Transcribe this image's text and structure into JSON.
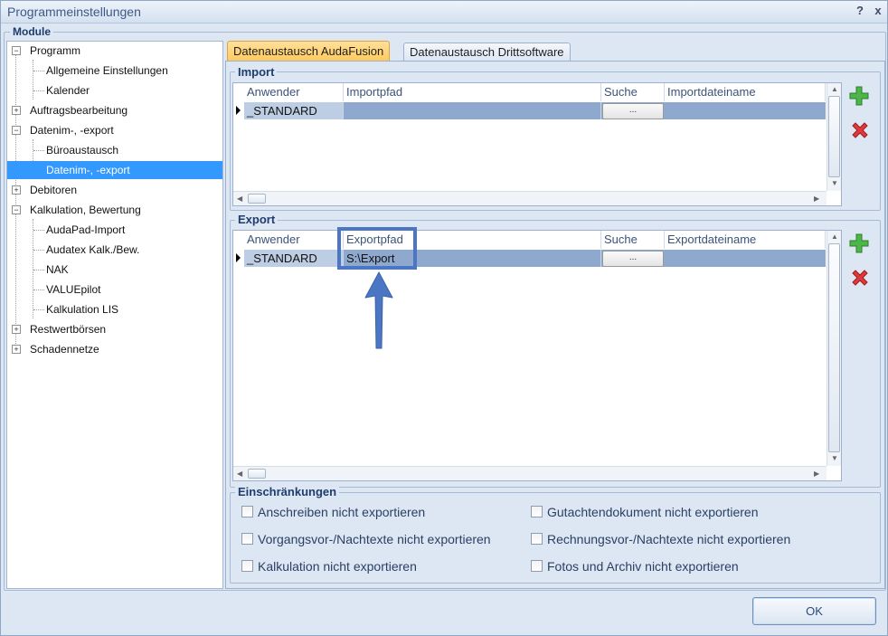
{
  "window": {
    "title": "Programmeinstellungen",
    "help": "?",
    "close": "x"
  },
  "module_group": {
    "label": "Module"
  },
  "tree": {
    "items": [
      {
        "label": "Programm",
        "level": 0,
        "expander": "−"
      },
      {
        "label": "Allgemeine Einstellungen",
        "level": 1
      },
      {
        "label": "Kalender",
        "level": 1
      },
      {
        "label": "Auftragsbearbeitung",
        "level": 0,
        "expander": "+"
      },
      {
        "label": "Datenim-, -export",
        "level": 0,
        "expander": "−"
      },
      {
        "label": "Büroaustausch",
        "level": 1
      },
      {
        "label": "Datenim-, -export",
        "level": 1,
        "selected": true
      },
      {
        "label": "Debitoren",
        "level": 0,
        "expander": "+"
      },
      {
        "label": "Kalkulation, Bewertung",
        "level": 0,
        "expander": "−"
      },
      {
        "label": "AudaPad-Import",
        "level": 1
      },
      {
        "label": "Audatex Kalk./Bew.",
        "level": 1
      },
      {
        "label": "NAK",
        "level": 1
      },
      {
        "label": "VALUEpilot",
        "level": 1
      },
      {
        "label": "Kalkulation LIS",
        "level": 1
      },
      {
        "label": "Restwertbörsen",
        "level": 0,
        "expander": "+"
      },
      {
        "label": "Schadennetze",
        "level": 0,
        "expander": "+"
      }
    ]
  },
  "tabs": [
    {
      "label": "Datenaustausch AudaFusion",
      "active": true
    },
    {
      "label": "Datenaustausch Drittsoftware",
      "active": false
    }
  ],
  "import": {
    "label": "Import",
    "columns": [
      "Anwender",
      "Importpfad",
      "Suche",
      "Importdateiname"
    ],
    "rows": [
      {
        "anwender": "_STANDARD",
        "pfad": "",
        "suche": "...",
        "dateiname": ""
      }
    ]
  },
  "export": {
    "label": "Export",
    "columns": [
      "Anwender",
      "Exportpfad",
      "Suche",
      "Exportdateiname"
    ],
    "rows": [
      {
        "anwender": "_STANDARD",
        "pfad": "S:\\Export",
        "suche": "...",
        "dateiname": ""
      }
    ]
  },
  "restrictions": {
    "label": "Einschränkungen",
    "items": [
      "Anschreiben nicht exportieren",
      "Gutachtendokument nicht exportieren",
      "Vorgangsvor-/Nachtexte nicht exportieren",
      "Rechnungsvor-/Nachtexte nicht exportieren",
      "Kalkulation nicht exportieren",
      "Fotos und Archiv nicht exportieren"
    ]
  },
  "footer": {
    "ok": "OK"
  },
  "colors": {
    "accent": "#3399ff",
    "tab_active": "#ffc95a",
    "highlight": "#4a76c4"
  }
}
